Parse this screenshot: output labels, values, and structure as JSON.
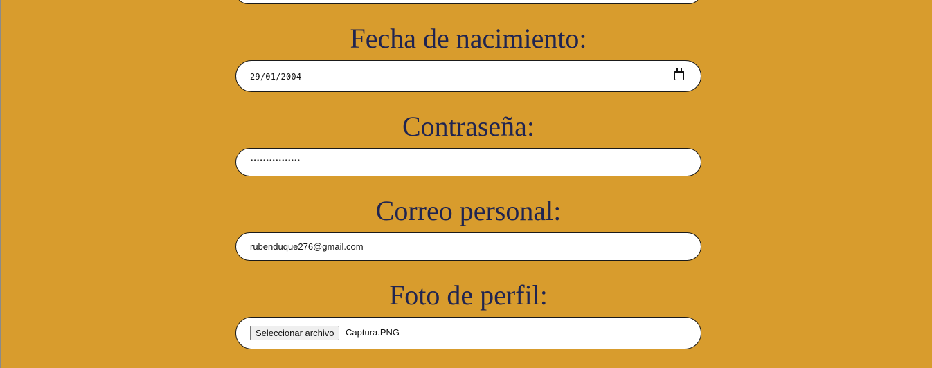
{
  "form": {
    "birth_date": {
      "label": "Fecha de nacimiento:",
      "value": "29/01/2004",
      "icon": "calendar-icon"
    },
    "password": {
      "label": "Contraseña:",
      "value_masked": "••••••••••••••••"
    },
    "email": {
      "label": "Correo personal:",
      "value": "rubenduque276@gmail.com"
    },
    "profile_photo": {
      "label": "Foto de perfil:",
      "button_label": "Seleccionar archivo",
      "file_name": "Captura.PNG"
    }
  },
  "colors": {
    "background": "#d89c2d",
    "label": "#1f2451",
    "field_background": "#ffffff",
    "field_border": "#1a1a1a"
  }
}
